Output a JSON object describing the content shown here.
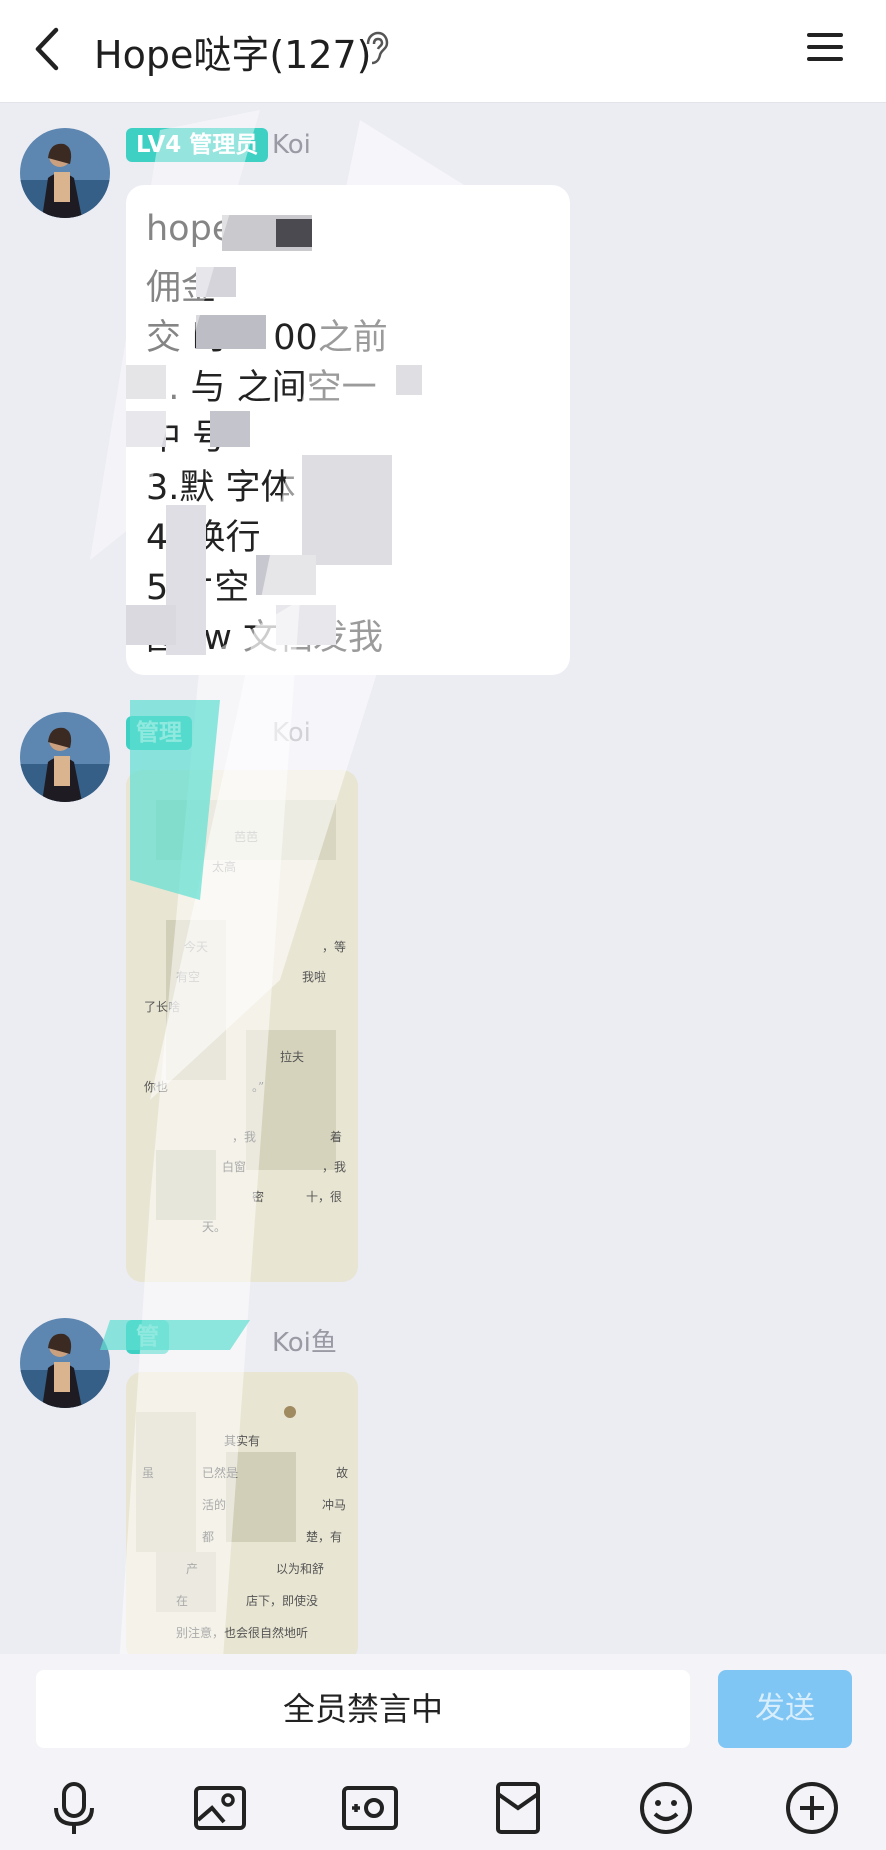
{
  "header": {
    "title": "Hope哒字(127)",
    "back_icon": "chevron-left-icon",
    "ear_icon": "ear-icon",
    "menu_icon": "hamburger-menu-icon"
  },
  "messages": [
    {
      "badge": "LV4 管理员",
      "sender": "Koi",
      "lines": [
        "hope",
        "佣金",
        "交  时    ：00之前",
        "1.  与   之间空一",
        "  中   号",
        "3.默  字体（   ）",
        "4.    换行     ",
        "5     片空     ",
        "     图     .w    文档发我"
      ]
    },
    {
      "badge": "管理",
      "sender": "Koi",
      "image_text": [
        "芭芭",
        "太高",
        "今天",
        "，等",
        "有空",
        "我啦",
        "了长啥",
        "拉夫",
        "你也",
        "。”",
        "，我",
        "着",
        "白窗",
        "，我",
        "密",
        "十，很",
        "天。"
      ]
    },
    {
      "badge": "管",
      "sender": "Koi鱼",
      "image_text": [
        "其实有",
        "虽",
        "已然是",
        "故",
        "活的",
        "冲马",
        "都",
        "楚，有",
        "产",
        "以为和舒",
        "在",
        "店下，即使没",
        "别注意，也会很自然地听"
      ]
    }
  ],
  "input": {
    "muted_label": "全员禁言中",
    "send_label": "发送"
  },
  "toolbar": [
    "microphone-icon",
    "image-icon",
    "camera-icon",
    "red-packet-icon",
    "emoji-icon",
    "plus-icon"
  ],
  "colors": {
    "accent": "#3fd0c4",
    "send": "#7fc6f5",
    "background": "#ececf3"
  }
}
